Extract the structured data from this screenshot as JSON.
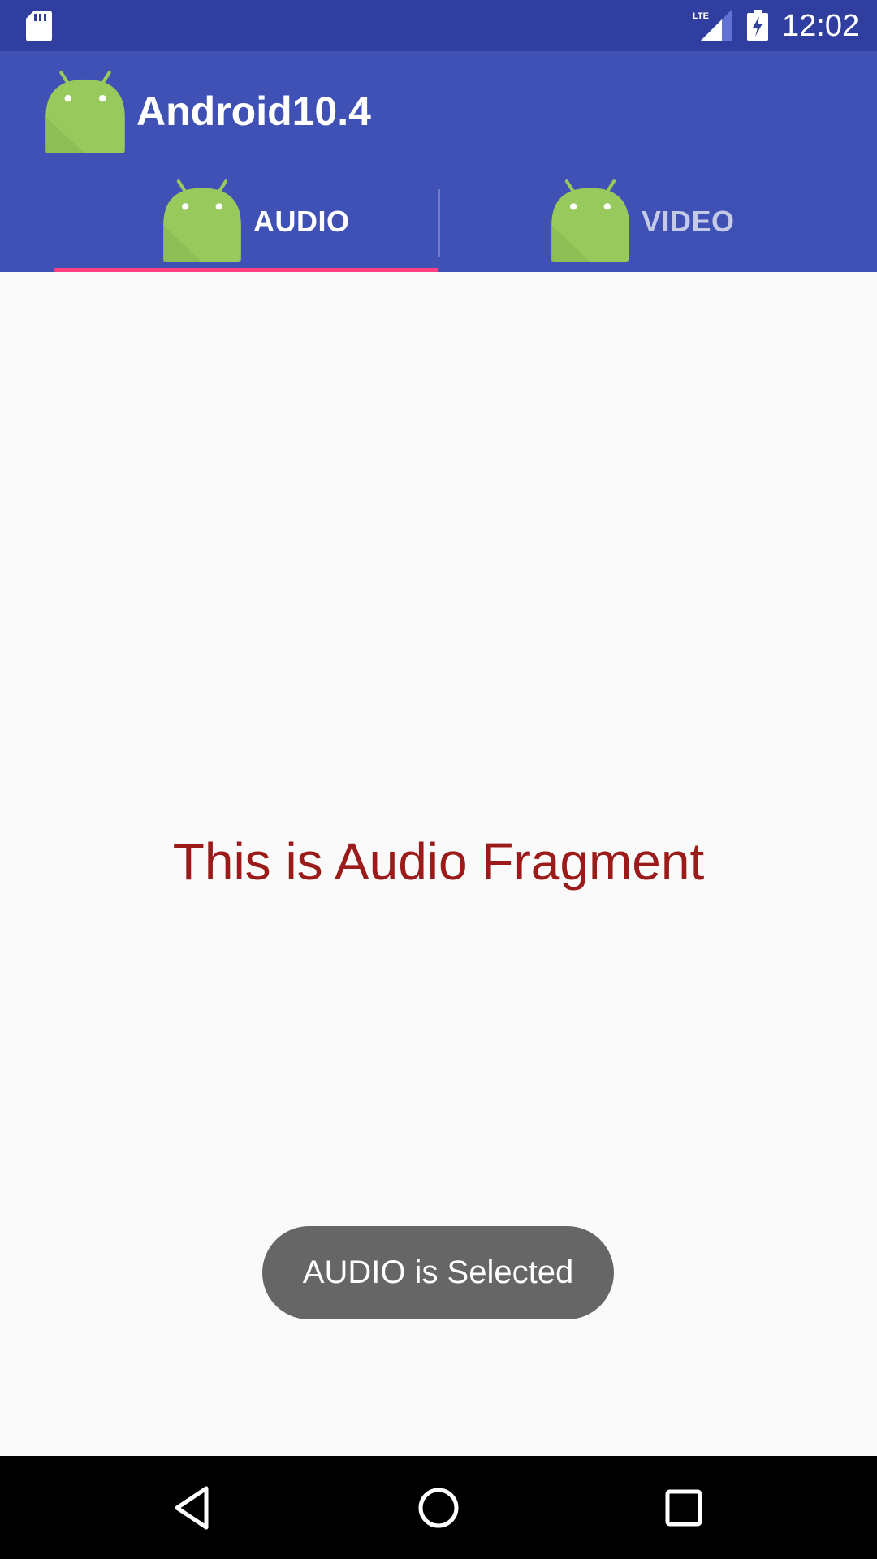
{
  "status_bar": {
    "time": "12:02",
    "network_label": "LTE",
    "icons": [
      "sd-card-icon",
      "lte-signal-icon",
      "battery-charging-icon"
    ]
  },
  "app_bar": {
    "title": "Android10.4",
    "logo_icon": "android-logo-icon",
    "background_color": "#3f51b5",
    "status_color": "#303f9f"
  },
  "tabs": [
    {
      "label": "AUDIO",
      "icon": "android-icon",
      "selected": true
    },
    {
      "label": "VIDEO",
      "icon": "android-icon",
      "selected": false
    }
  ],
  "tab_indicator_color": "#ff4081",
  "content": {
    "fragment_text": "This is Audio Fragment",
    "fragment_text_color": "#9b1b1b"
  },
  "toast": {
    "message": "AUDIO is Selected"
  },
  "nav_bar": {
    "buttons": [
      "back-icon",
      "home-icon",
      "recents-icon"
    ]
  }
}
